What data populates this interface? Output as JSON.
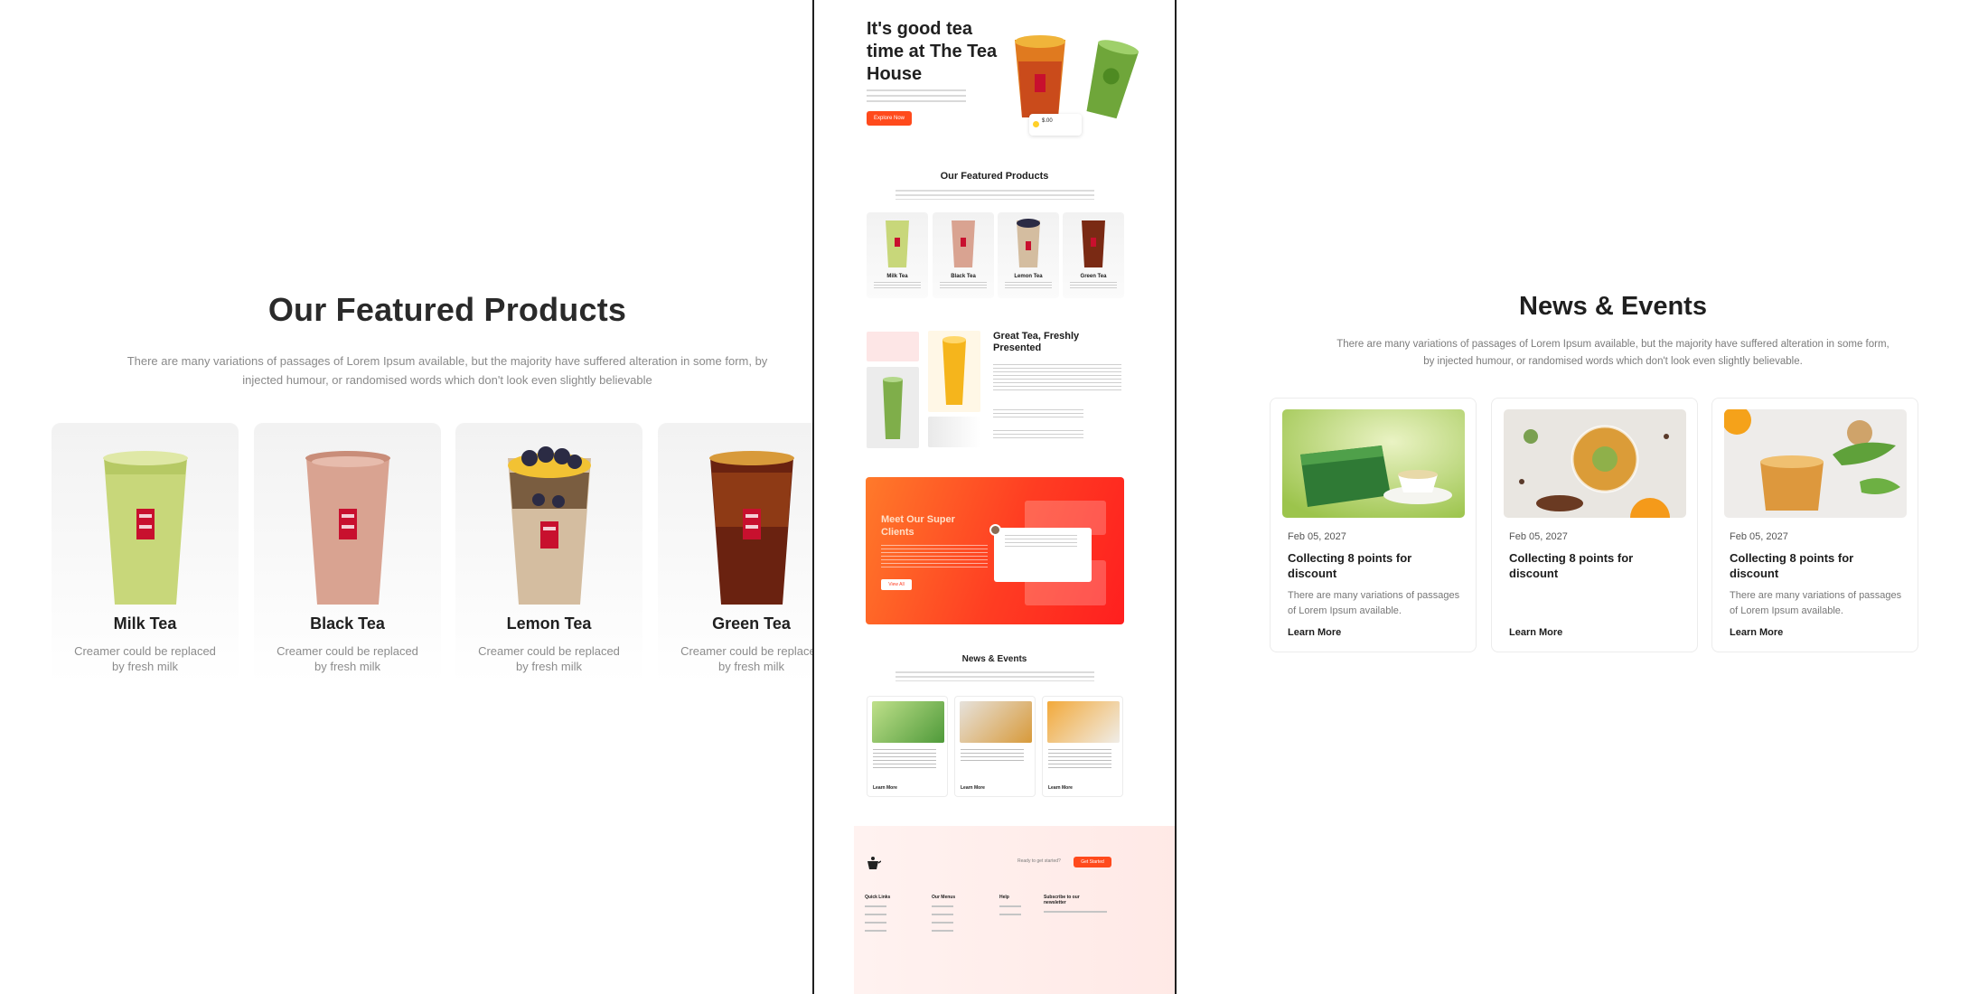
{
  "featured": {
    "title": "Our Featured Products",
    "subtitle": "There are many variations of passages of Lorem Ipsum available, but the majority have suffered alteration in some form, by injected humour, or randomised words which don't look even slightly believable",
    "products": [
      {
        "name": "Milk Tea",
        "desc": "Creamer could be replaced by fresh milk",
        "color": "#c8d77a"
      },
      {
        "name": "Black Tea",
        "desc": "Creamer could be replaced by fresh milk",
        "color": "#d9a391"
      },
      {
        "name": "Lemon Tea",
        "desc": "Creamer could be replaced by fresh milk",
        "color": "#cdb394"
      },
      {
        "name": "Green Tea",
        "desc": "Creamer could be replaced by fresh milk",
        "color": "#7a2a14"
      }
    ]
  },
  "mockup": {
    "hero_title": "It's good tea time at The Tea House",
    "hero_button": "Explore Now",
    "hero_price": "$.00",
    "featured_title": "Our Featured Products",
    "mini_products": [
      "Milk Tea",
      "Black Tea",
      "Lemon Tea",
      "Green Tea"
    ],
    "about_title": "Great Tea, Freshly Presented",
    "clients_title": "Meet Our Super Clients",
    "clients_button": "View All",
    "news_title": "News & Events",
    "news_more": [
      "Learn More",
      "Learn More",
      "Learn More"
    ],
    "footer_ready": "Ready to get started?",
    "footer_button": "Get Started",
    "footer_cols": [
      "Quick Links",
      "Our Menus",
      "Help",
      "Subscribe to our newsletter"
    ]
  },
  "news": {
    "title": "News & Events",
    "subtitle": "There are many variations of passages of Lorem Ipsum available, but the majority have suffered alteration in some form, by injected humour, or randomised words which don't look even slightly believable.",
    "items": [
      {
        "date": "Feb 05, 2027",
        "title": "Collecting 8 points for discount",
        "desc": "There are many variations of passages of Lorem Ipsum available.",
        "link": "Learn More"
      },
      {
        "date": "Feb 05, 2027",
        "title": "Collecting 8 points for discount",
        "desc": "",
        "link": "Learn More"
      },
      {
        "date": "Feb 05, 2027",
        "title": "Collecting 8 points for discount",
        "desc": "There are many variations of passages of Lorem Ipsum available.",
        "link": "Learn More"
      }
    ]
  },
  "colors": {
    "accent": "#ff4a1c",
    "card_bg": "#f5f5f5"
  }
}
